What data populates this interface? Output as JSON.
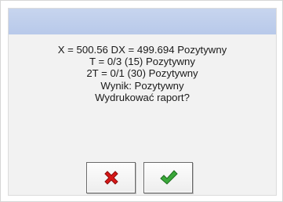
{
  "dialog": {
    "lines": [
      "X = 500.56 DX = 499.694 Pozytywny",
      "T = 0/3 (15) Pozytywny",
      "2T = 0/1 (30) Pozytywny",
      "Wynik: Pozytywny",
      "Wydrukować raport?"
    ]
  },
  "buttons": {
    "cancel_icon": "close-icon",
    "confirm_icon": "checkmark-icon"
  },
  "colors": {
    "title_bar": "#bccbea",
    "dialog_bg": "#f2f2f2",
    "cancel_red": "#d81818",
    "confirm_green": "#2e9a2e"
  }
}
